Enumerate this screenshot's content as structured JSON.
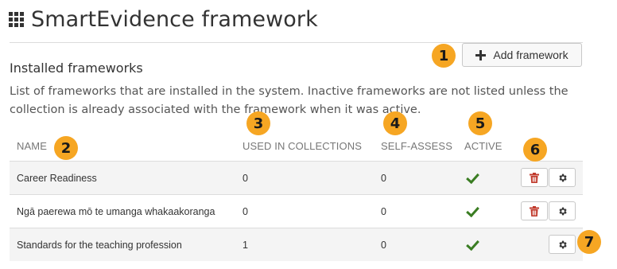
{
  "header": {
    "title": "SmartEvidence framework",
    "title_icon": "grid-icon"
  },
  "toolbar": {
    "add_label": "Add framework",
    "add_icon": "plus-icon"
  },
  "section": {
    "heading": "Installed frameworks",
    "description": "List of frameworks that are installed in the system. Inactive frameworks are not listed unless the collection is already associated with the framework when it was active."
  },
  "table": {
    "columns": [
      "NAME",
      "USED IN COLLECTIONS",
      "SELF-ASSESS",
      "ACTIVE"
    ],
    "rows": [
      {
        "name": "Career Readiness",
        "used": "0",
        "self_assess": "0",
        "active": true,
        "deletable": true
      },
      {
        "name": "Ngā paerewa mō te umanga whakaakoranga",
        "used": "0",
        "self_assess": "0",
        "active": true,
        "deletable": true
      },
      {
        "name": "Standards for the teaching profession",
        "used": "1",
        "self_assess": "0",
        "active": true,
        "deletable": false
      }
    ]
  },
  "callouts": [
    "1",
    "2",
    "3",
    "4",
    "5",
    "6",
    "7"
  ],
  "colors": {
    "callout": "#f6a623",
    "check": "#3a7d22",
    "delete": "#c0392b",
    "row_alt": "#f4f4f4"
  }
}
